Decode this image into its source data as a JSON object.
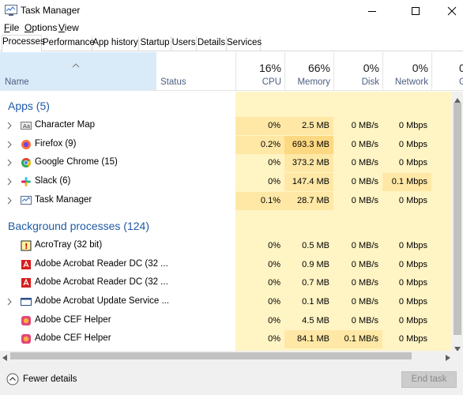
{
  "window": {
    "title": "Task Manager"
  },
  "menu": [
    {
      "label": "File",
      "accel": "F",
      "rest": "ile"
    },
    {
      "label": "Options",
      "accel": "O",
      "rest": "ptions"
    },
    {
      "label": "View",
      "accel": "V",
      "rest": "iew"
    }
  ],
  "tabs": [
    "Processes",
    "Performance",
    "App history",
    "Startup",
    "Users",
    "Details",
    "Services"
  ],
  "active_tab": "Processes",
  "columns": {
    "name": "Name",
    "status": "Status",
    "cpu": {
      "pct": "16%",
      "label": "CPU"
    },
    "memory": {
      "pct": "66%",
      "label": "Memory"
    },
    "disk": {
      "pct": "0%",
      "label": "Disk"
    },
    "network": {
      "pct": "0%",
      "label": "Network"
    },
    "gpu": {
      "pct": "0",
      "label": "G"
    }
  },
  "groups": {
    "apps": "Apps (5)",
    "background": "Background processes (124)"
  },
  "apps": [
    {
      "name": "Character Map",
      "icon": "character-map-icon",
      "cpu": "0%",
      "memory": "2.5 MB",
      "disk": "0 MB/s",
      "network": "0 Mbps"
    },
    {
      "name": "Firefox (9)",
      "icon": "firefox-icon",
      "cpu": "0.2%",
      "memory": "693.3 MB",
      "disk": "0 MB/s",
      "network": "0 Mbps"
    },
    {
      "name": "Google Chrome (15)",
      "icon": "chrome-icon",
      "cpu": "0%",
      "memory": "373.2 MB",
      "disk": "0 MB/s",
      "network": "0 Mbps"
    },
    {
      "name": "Slack (6)",
      "icon": "slack-icon",
      "cpu": "0%",
      "memory": "147.4 MB",
      "disk": "0 MB/s",
      "network": "0.1 Mbps"
    },
    {
      "name": "Task Manager",
      "icon": "task-manager-icon",
      "cpu": "0.1%",
      "memory": "28.7 MB",
      "disk": "0 MB/s",
      "network": "0 Mbps"
    }
  ],
  "background": [
    {
      "name": "AcroTray (32 bit)",
      "icon": "acrotray-icon",
      "cpu": "0%",
      "memory": "0.5 MB",
      "disk": "0 MB/s",
      "network": "0 Mbps"
    },
    {
      "name": "Adobe Acrobat Reader DC (32 ...",
      "icon": "acrobat-icon",
      "cpu": "0%",
      "memory": "0.9 MB",
      "disk": "0 MB/s",
      "network": "0 Mbps"
    },
    {
      "name": "Adobe Acrobat Reader DC (32 ...",
      "icon": "acrobat-icon",
      "cpu": "0%",
      "memory": "0.7 MB",
      "disk": "0 MB/s",
      "network": "0 Mbps"
    },
    {
      "name": "Adobe Acrobat Update Service ...",
      "icon": "service-window-icon",
      "cpu": "0%",
      "memory": "0.1 MB",
      "disk": "0 MB/s",
      "network": "0 Mbps"
    },
    {
      "name": "Adobe CEF Helper",
      "icon": "adobe-cef-icon",
      "cpu": "0%",
      "memory": "4.5 MB",
      "disk": "0 MB/s",
      "network": "0 Mbps"
    },
    {
      "name": "Adobe CEF Helper",
      "icon": "adobe-cef-icon",
      "cpu": "0%",
      "memory": "84.1 MB",
      "disk": "0.1 MB/s",
      "network": "0 Mbps"
    }
  ],
  "footer": {
    "fewer_details": "Fewer details",
    "end_task": "End task"
  },
  "colors": {
    "heat_light": "#fff4c4",
    "heat_mid": "#ffe8a6",
    "heat_strong": "#fdd882",
    "header_sel": "#d9ebf9",
    "group_text": "#1f5aa6"
  }
}
